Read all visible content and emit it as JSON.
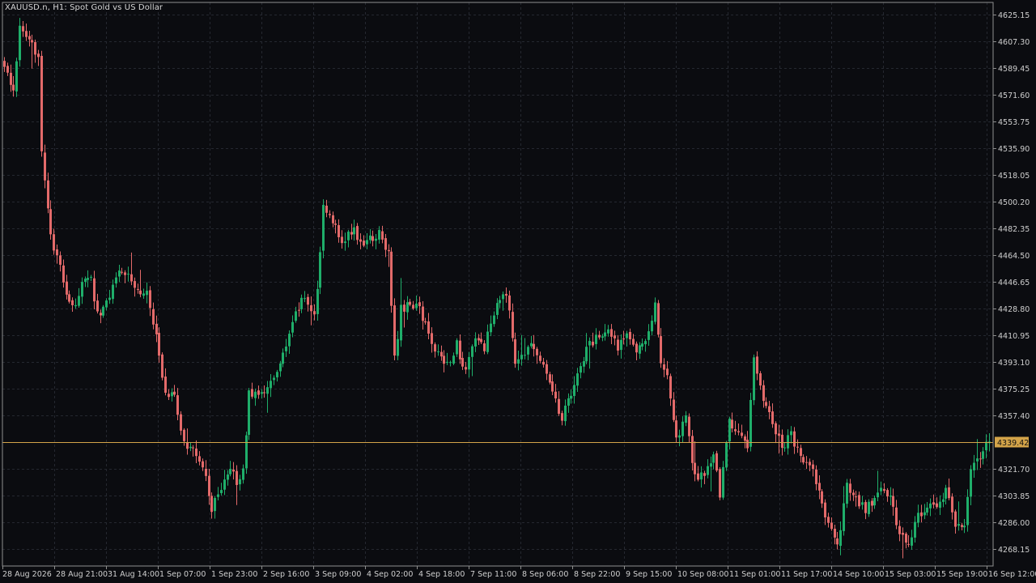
{
  "title": "XAUUSD.n, H1:  Spot Gold vs US Dollar",
  "colors": {
    "background": "#0b0c10",
    "grid": "#252830",
    "frame": "#8f8f8f",
    "bullish": "#1fae6a",
    "bearish": "#e36a6a",
    "current_price_line": "#d4a449",
    "current_price_label_bg": "#d4a449",
    "text": "#cfcfcf"
  },
  "chart_data": {
    "type": "candlestick",
    "symbol": "XAUUSD.n",
    "timeframe": "H1",
    "ylim": [
      4257.0,
      4633.0
    ],
    "current_price": 4339.42,
    "current_price_label": "4339.42",
    "y_ticks": [
      "4625.15",
      "4607.30",
      "4589.45",
      "4571.60",
      "4553.75",
      "4535.90",
      "4518.05",
      "4500.20",
      "4482.35",
      "4464.50",
      "4446.65",
      "4428.80",
      "4410.95",
      "4393.10",
      "4375.25",
      "4357.40",
      "4321.70",
      "4303.85",
      "4286.00",
      "4268.15"
    ],
    "x_ticks": [
      "28 Aug 2026",
      "28 Aug 21:00",
      "31 Aug 14:00",
      "1 Sep 07:00",
      "1 Sep 23:00",
      "2 Sep 16:00",
      "3 Sep 09:00",
      "4 Sep 02:00",
      "4 Sep 18:00",
      "7 Sep 11:00",
      "8 Sep 06:00",
      "8 Sep 22:00",
      "9 Sep 15:00",
      "10 Sep 08:00",
      "11 Sep 01:00",
      "11 Sep 17:00",
      "14 Sep 10:00",
      "15 Sep 03:00",
      "15 Sep 19:00",
      "16 Sep 12:00"
    ],
    "anchors": [
      [
        0,
        4590
      ],
      [
        3,
        4575
      ],
      [
        5,
        4615
      ],
      [
        8,
        4605
      ],
      [
        11,
        4600
      ],
      [
        12,
        4535
      ],
      [
        15,
        4475
      ],
      [
        18,
        4455
      ],
      [
        20,
        4440
      ],
      [
        22,
        4428
      ],
      [
        25,
        4445
      ],
      [
        28,
        4448
      ],
      [
        30,
        4425
      ],
      [
        33,
        4432
      ],
      [
        36,
        4452
      ],
      [
        40,
        4455
      ],
      [
        43,
        4440
      ],
      [
        46,
        4440
      ],
      [
        50,
        4400
      ],
      [
        52,
        4370
      ],
      [
        55,
        4370
      ],
      [
        58,
        4338
      ],
      [
        60,
        4335
      ],
      [
        63,
        4330
      ],
      [
        65,
        4315
      ],
      [
        67,
        4295
      ],
      [
        70,
        4310
      ],
      [
        73,
        4325
      ],
      [
        75,
        4310
      ],
      [
        77,
        4320
      ],
      [
        79,
        4375
      ],
      [
        82,
        4368
      ],
      [
        85,
        4378
      ],
      [
        88,
        4385
      ],
      [
        91,
        4402
      ],
      [
        94,
        4425
      ],
      [
        97,
        4437
      ],
      [
        100,
        4425
      ],
      [
        101,
        4440
      ],
      [
        103,
        4495
      ],
      [
        106,
        4488
      ],
      [
        109,
        4475
      ],
      [
        113,
        4480
      ],
      [
        116,
        4472
      ],
      [
        119,
        4475
      ],
      [
        121,
        4480
      ],
      [
        124,
        4465
      ],
      [
        126,
        4395
      ],
      [
        128,
        4428
      ],
      [
        131,
        4432
      ],
      [
        134,
        4430
      ],
      [
        137,
        4410
      ],
      [
        140,
        4398
      ],
      [
        143,
        4392
      ],
      [
        146,
        4405
      ],
      [
        149,
        4385
      ],
      [
        152,
        4410
      ],
      [
        155,
        4403
      ],
      [
        158,
        4425
      ],
      [
        161,
        4440
      ],
      [
        163,
        4428
      ],
      [
        165,
        4395
      ],
      [
        168,
        4398
      ],
      [
        171,
        4405
      ],
      [
        174,
        4388
      ],
      [
        177,
        4375
      ],
      [
        180,
        4355
      ],
      [
        183,
        4372
      ],
      [
        186,
        4390
      ],
      [
        189,
        4405
      ],
      [
        192,
        4410
      ],
      [
        195,
        4415
      ],
      [
        198,
        4402
      ],
      [
        201,
        4415
      ],
      [
        204,
        4402
      ],
      [
        207,
        4410
      ],
      [
        210,
        4430
      ],
      [
        212,
        4395
      ],
      [
        214,
        4385
      ],
      [
        217,
        4340
      ],
      [
        220,
        4355
      ],
      [
        223,
        4315
      ],
      [
        226,
        4320
      ],
      [
        229,
        4330
      ],
      [
        231,
        4305
      ],
      [
        234,
        4355
      ],
      [
        237,
        4345
      ],
      [
        240,
        4335
      ],
      [
        242,
        4395
      ],
      [
        245,
        4370
      ],
      [
        248,
        4355
      ],
      [
        251,
        4335
      ],
      [
        254,
        4345
      ],
      [
        257,
        4328
      ],
      [
        260,
        4325
      ],
      [
        263,
        4305
      ],
      [
        266,
        4285
      ],
      [
        269,
        4268
      ],
      [
        272,
        4310
      ],
      [
        275,
        4300
      ],
      [
        278,
        4295
      ],
      [
        281,
        4300
      ],
      [
        283,
        4310
      ],
      [
        286,
        4302
      ],
      [
        289,
        4280
      ],
      [
        292,
        4270
      ],
      [
        295,
        4290
      ],
      [
        298,
        4298
      ],
      [
        301,
        4297
      ],
      [
        304,
        4308
      ],
      [
        307,
        4285
      ],
      [
        310,
        4282
      ],
      [
        312,
        4322
      ],
      [
        315,
        4330
      ],
      [
        318,
        4340
      ]
    ]
  }
}
